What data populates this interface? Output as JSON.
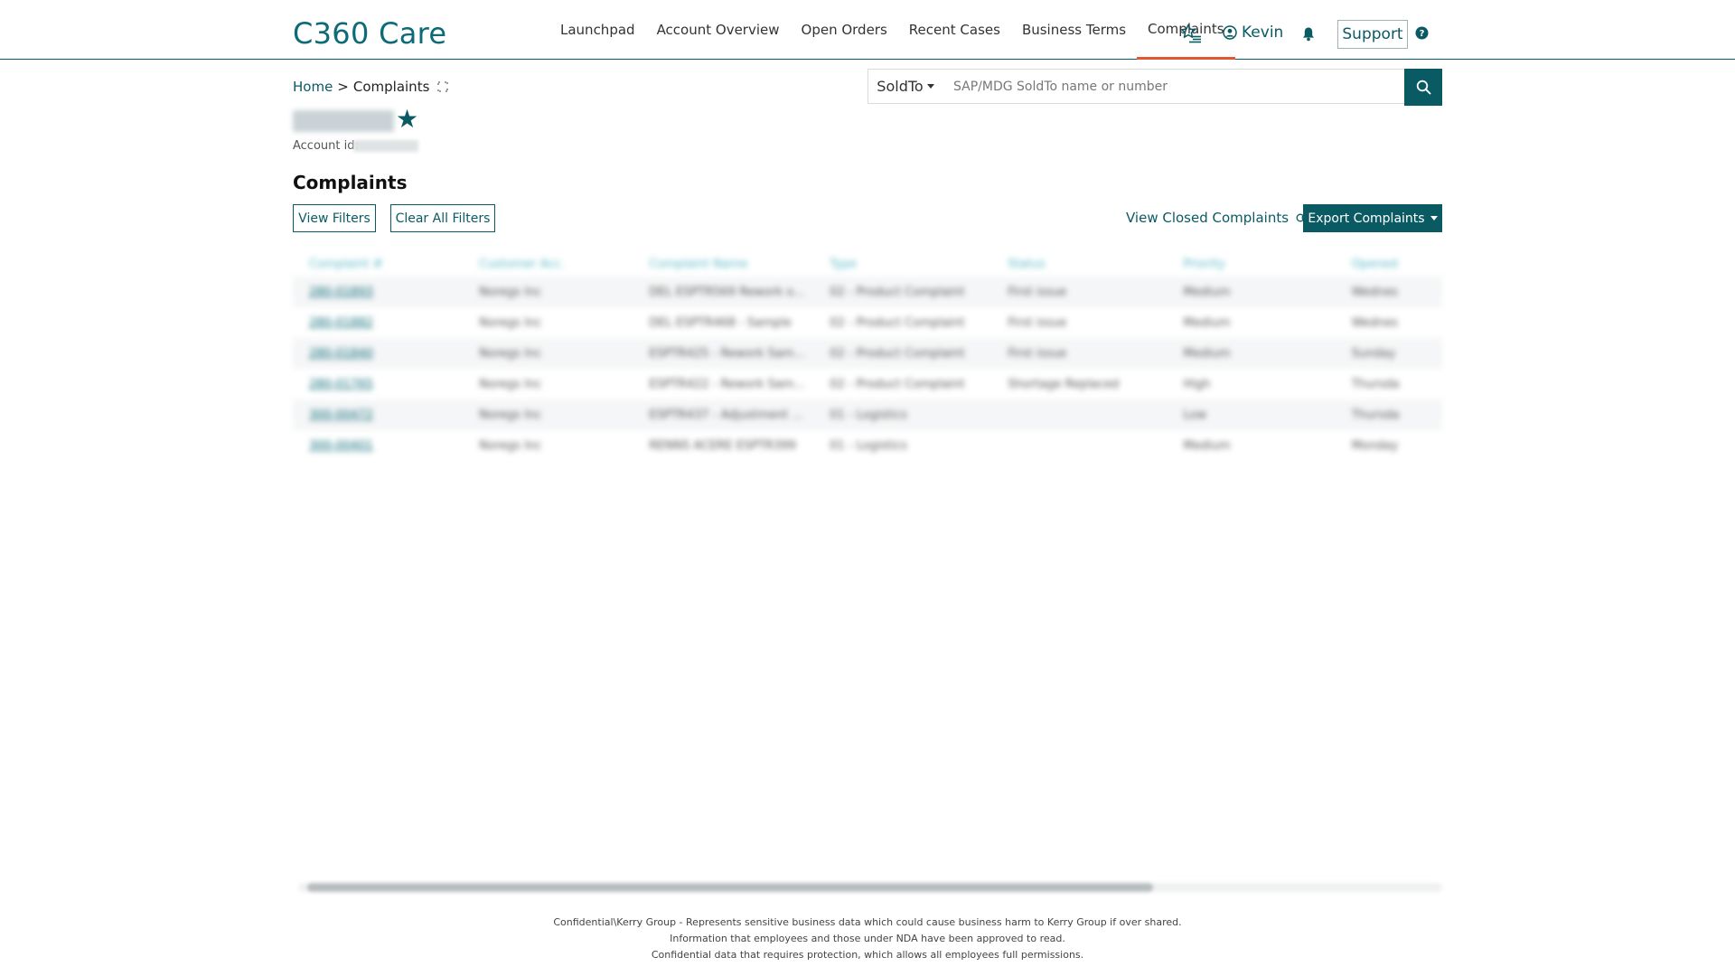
{
  "header": {
    "brand": "C360 Care",
    "nav": [
      "Launchpad",
      "Account Overview",
      "Open Orders",
      "Recent Cases",
      "Business Terms",
      "Complaints"
    ],
    "active_nav": "Complaints",
    "user_name": "Kevin",
    "support_label": "Support"
  },
  "breadcrumb": {
    "home": "Home",
    "separator": ">",
    "current": "Complaints"
  },
  "search": {
    "scope_label": "SoldTo",
    "placeholder": "SAP/MDG SoldTo name or number"
  },
  "account": {
    "id_label": "Account id:"
  },
  "page": {
    "title": "Complaints",
    "view_filters_label": "View Filters",
    "clear_filters_label": "Clear All Filters",
    "view_closed_label": "View Closed Complaints",
    "export_label": "Export Complaints"
  },
  "table": {
    "headers": [
      "Complaint #",
      "Customer Acc.",
      "Complaint Name",
      "Type",
      "Status",
      "Priority",
      "Opened"
    ],
    "rows": [
      [
        "280-01893",
        "Noregs Inc",
        "DEL ESPTR569 Rework o...",
        "02 - Product Complaint",
        "First issue",
        "Medium",
        "Wednes"
      ],
      [
        "280-01882",
        "Noregs Inc",
        "DEL ESPTR468 - Sample",
        "02 - Product Complaint",
        "First issue",
        "Medium",
        "Wednes"
      ],
      [
        "280-01840",
        "Noregs Inc",
        "ESPTR425 - Rework Sam...",
        "02 - Product Complaint",
        "First issue",
        "Medium",
        "Sunday"
      ],
      [
        "280-01765",
        "Noregs Inc",
        "ESPTR422 - Rework Sam...",
        "02 - Product Complaint",
        "Shortage Replaced",
        "High",
        "Thursda"
      ],
      [
        "300-00472",
        "Noregs Inc",
        "ESPTR437 - Adjustment ...",
        "01 - Logistics",
        "",
        "Low",
        "Thursda"
      ],
      [
        "300-00401",
        "Noregs Inc",
        "RENNS ACERE ESPTR399",
        "01 - Logistics",
        "",
        "Medium",
        "Monday"
      ]
    ]
  },
  "footer": {
    "line1": "Confidential\\Kerry Group - Represents sensitive business data which could cause business harm to Kerry Group if over shared.",
    "line2": "Information that employees and those under NDA have been approved to read.",
    "line3": "Confidential data that requires protection, which allows all employees full permissions."
  },
  "icons": {
    "favorites": "favorites-list-icon",
    "user": "user-circle-icon",
    "notifications": "bell-icon",
    "help": "question-circle-icon",
    "search": "search-icon",
    "expand": "expand-icon",
    "toggle": "toggle-icon",
    "star": "star-icon"
  },
  "colors": {
    "primary": "#0a5a63",
    "brand": "#0b6b77",
    "active_tab_underline": "#e2572b",
    "table_header": "#57b8c6"
  }
}
